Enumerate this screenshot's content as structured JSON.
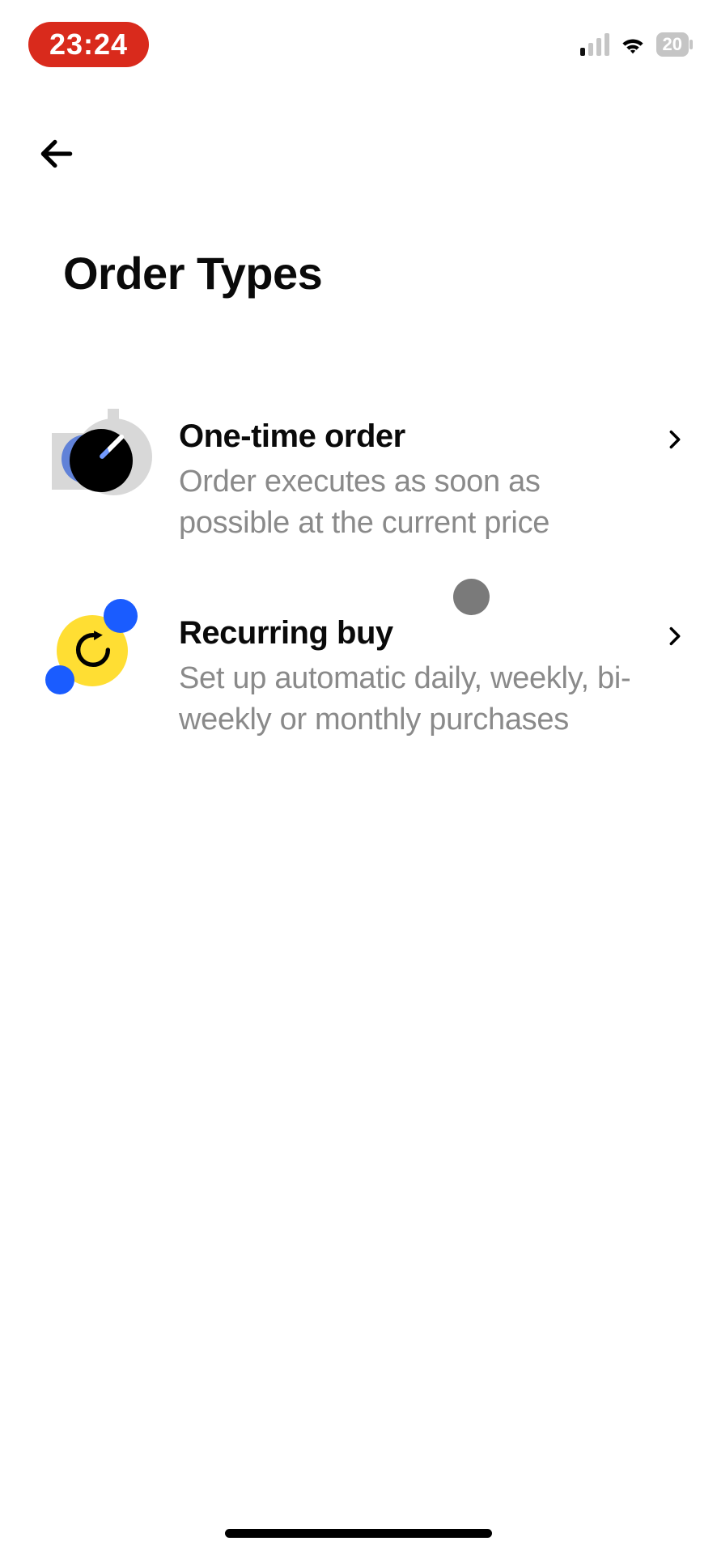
{
  "status_bar": {
    "time": "23:24",
    "battery_text": "20"
  },
  "page": {
    "title": "Order Types"
  },
  "options": [
    {
      "title": "One-time order",
      "description": "Order executes as soon as possible at the current price"
    },
    {
      "title": "Recurring buy",
      "description": "Set up automatic daily, weekly, bi-weekly or monthly purchases"
    }
  ]
}
